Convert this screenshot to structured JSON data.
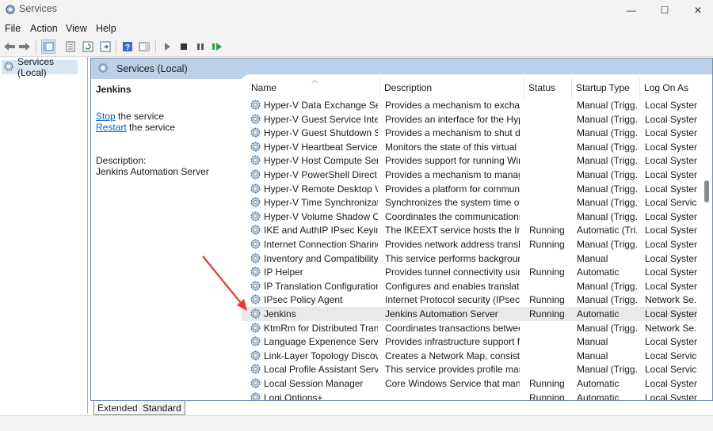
{
  "window": {
    "title": "Services",
    "minimize_glyph": "—",
    "maximize_glyph": "☐",
    "close_glyph": "✕"
  },
  "menu": [
    "File",
    "Action",
    "View",
    "Help"
  ],
  "toolbar_icons": [
    "back-icon",
    "forward-icon",
    "show-hide-console-tree-icon",
    "properties-icon",
    "refresh-icon",
    "export-list-icon",
    "help-icon",
    "show-action-pane-icon",
    "start-service-icon",
    "stop-service-icon",
    "pause-service-icon",
    "restart-service-icon"
  ],
  "tree": {
    "root_label": "Services (Local)"
  },
  "pane": {
    "header": "Services (Local)"
  },
  "extended": {
    "service_name": "Jenkins",
    "stop_link": "Stop",
    "stop_suffix": " the service",
    "restart_link": "Restart",
    "restart_suffix": " the service",
    "description_label": "Description:",
    "description": "Jenkins Automation Server"
  },
  "columns": {
    "name": "Name",
    "description": "Description",
    "status": "Status",
    "startup": "Startup Type",
    "logon": "Log On As"
  },
  "services": [
    {
      "name": "Hyper-V Data Exchange Serv...",
      "description": "Provides a mechanism to exchang...",
      "status": "",
      "startup": "Manual (Trigg...",
      "logon": "Local System"
    },
    {
      "name": "Hyper-V Guest Service Interf...",
      "description": "Provides an interface for the Hype...",
      "status": "",
      "startup": "Manual (Trigg...",
      "logon": "Local System"
    },
    {
      "name": "Hyper-V Guest Shutdown Se...",
      "description": "Provides a mechanism to shut do...",
      "status": "",
      "startup": "Manual (Trigg...",
      "logon": "Local System"
    },
    {
      "name": "Hyper-V Heartbeat Service",
      "description": "Monitors the state of this virtual ...",
      "status": "",
      "startup": "Manual (Trigg...",
      "logon": "Local System"
    },
    {
      "name": "Hyper-V Host Compute Serv...",
      "description": "Provides support for running Win...",
      "status": "",
      "startup": "Manual (Trigg...",
      "logon": "Local System"
    },
    {
      "name": "Hyper-V PowerShell Direct S...",
      "description": "Provides a mechanism to manage...",
      "status": "",
      "startup": "Manual (Trigg...",
      "logon": "Local System"
    },
    {
      "name": "Hyper-V Remote Desktop Vi...",
      "description": "Provides a platform for communic...",
      "status": "",
      "startup": "Manual (Trigg...",
      "logon": "Local System"
    },
    {
      "name": "Hyper-V Time Synchronizati...",
      "description": "Synchronizes the system time of t...",
      "status": "",
      "startup": "Manual (Trigg...",
      "logon": "Local Service"
    },
    {
      "name": "Hyper-V Volume Shadow Co...",
      "description": "Coordinates the communications ...",
      "status": "",
      "startup": "Manual (Trigg...",
      "logon": "Local System"
    },
    {
      "name": "IKE and AuthIP IPsec Keying ...",
      "description": "The IKEEXT service hosts the Inter...",
      "status": "Running",
      "startup": "Automatic (Tri...",
      "logon": "Local System"
    },
    {
      "name": "Internet Connection Sharing...",
      "description": "Provides network address translat...",
      "status": "Running",
      "startup": "Manual (Trigg...",
      "logon": "Local System"
    },
    {
      "name": "Inventory and Compatibility...",
      "description": "This service performs background...",
      "status": "",
      "startup": "Manual",
      "logon": "Local System"
    },
    {
      "name": "IP Helper",
      "description": "Provides tunnel connectivity usin...",
      "status": "Running",
      "startup": "Automatic",
      "logon": "Local System"
    },
    {
      "name": "IP Translation Configuration ...",
      "description": "Configures and enables translatio...",
      "status": "",
      "startup": "Manual (Trigg...",
      "logon": "Local System"
    },
    {
      "name": "IPsec Policy Agent",
      "description": "Internet Protocol security (IPsec) s...",
      "status": "Running",
      "startup": "Manual (Trigg...",
      "logon": "Network Se..."
    },
    {
      "name": "Jenkins",
      "description": "Jenkins Automation Server",
      "status": "Running",
      "startup": "Automatic",
      "logon": "Local System",
      "selected": true
    },
    {
      "name": "KtmRm for Distributed Trans...",
      "description": "Coordinates transactions between...",
      "status": "",
      "startup": "Manual (Trigg...",
      "logon": "Network Se..."
    },
    {
      "name": "Language Experience Service",
      "description": "Provides infrastructure support fo...",
      "status": "",
      "startup": "Manual",
      "logon": "Local System"
    },
    {
      "name": "Link-Layer Topology Discove...",
      "description": "Creates a Network Map, consistin...",
      "status": "",
      "startup": "Manual",
      "logon": "Local Service"
    },
    {
      "name": "Local Profile Assistant Service",
      "description": "This service provides profile mana...",
      "status": "",
      "startup": "Manual (Trigg...",
      "logon": "Local Service"
    },
    {
      "name": "Local Session Manager",
      "description": "Core Windows Service that mana...",
      "status": "Running",
      "startup": "Automatic",
      "logon": "Local System"
    },
    {
      "name": "Logi Options+",
      "description": "",
      "status": "Running",
      "startup": "Automatic",
      "logon": "Local System"
    }
  ],
  "tabs": {
    "extended": "Extended",
    "standard": "Standard"
  },
  "colors": {
    "pane_header": "#bcd0e8",
    "selection": "#e9e9e9",
    "link": "#0066cc",
    "annotation_arrow": "#e53935"
  }
}
